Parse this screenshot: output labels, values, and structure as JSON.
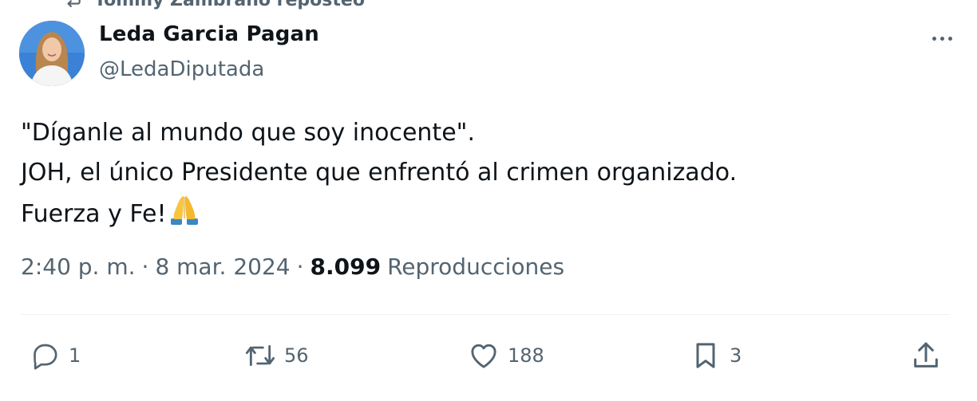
{
  "repost_banner": {
    "text": "Tommy Zambrano reposteó",
    "icon": "repost-icon"
  },
  "author": {
    "display_name": "Leda Garcia Pagan",
    "handle": "@LedaDiputada",
    "avatar_icon": "avatar-photo"
  },
  "tweet": {
    "lines": [
      "\"Díganle al mundo que soy inocente\".",
      "JOH, el único Presidente que enfrentó al crimen organizado.",
      "Fuerza y Fe!"
    ],
    "emoji": "folded-hands-emoji"
  },
  "meta": {
    "time": "2:40 p. m.",
    "date": "8 mar. 2024",
    "views_count": "8.099",
    "views_label": "Reproducciones"
  },
  "actions": {
    "replies": "1",
    "reposts": "56",
    "likes": "188",
    "bookmarks": "3"
  },
  "colors": {
    "text_primary": "#0f1419",
    "text_secondary": "#536471",
    "divider": "#eff3f4"
  }
}
